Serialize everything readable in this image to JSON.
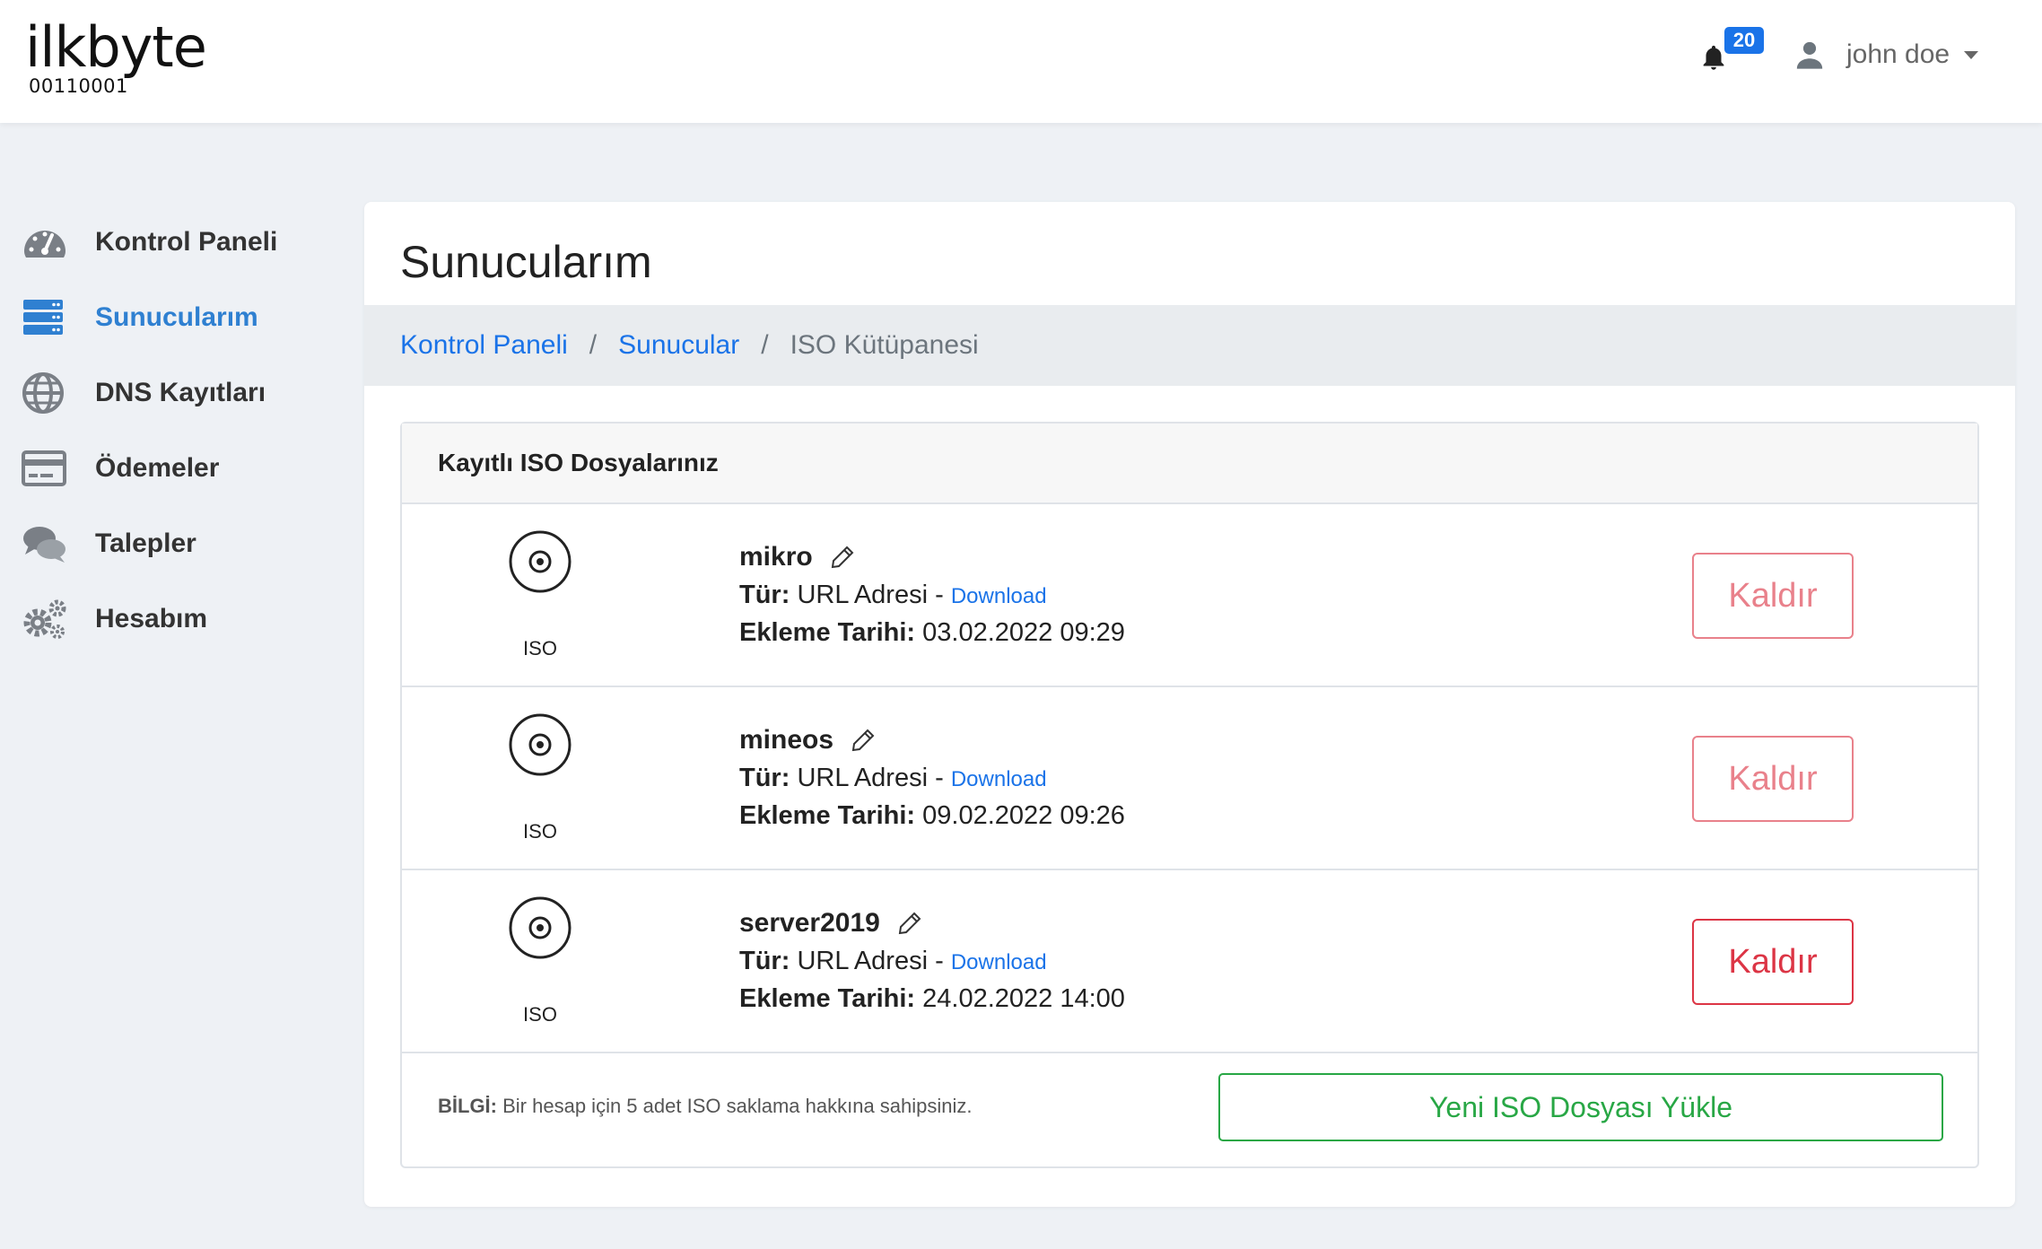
{
  "brand": {
    "name": "ilkbyte",
    "tagline": "00110001"
  },
  "header": {
    "notification_count": "20",
    "user_name": "john doe"
  },
  "sidebar": {
    "items": [
      {
        "label": "Kontrol Paneli",
        "icon": "dashboard-gauge-icon",
        "active": false
      },
      {
        "label": "Sunucularım",
        "icon": "server-icon",
        "active": true
      },
      {
        "label": "DNS Kayıtları",
        "icon": "globe-icon",
        "active": false
      },
      {
        "label": "Ödemeler",
        "icon": "credit-card-icon",
        "active": false
      },
      {
        "label": "Talepler",
        "icon": "chat-bubbles-icon",
        "active": false
      },
      {
        "label": "Hesabım",
        "icon": "gears-icon",
        "active": false
      }
    ]
  },
  "page": {
    "title": "Sunucularım",
    "breadcrumb": [
      "Kontrol Paneli",
      "Sunucular",
      "ISO Kütüpanesi"
    ],
    "separator": "/"
  },
  "panel": {
    "title": "Kayıtlı ISO Dosyalarınız",
    "type_label": "Tür:",
    "date_label": "Ekleme Tarihi:",
    "dash": "-",
    "iso_rows": [
      {
        "icon_label": "ISO",
        "name": "mikro",
        "type": "URL Adresi",
        "download": "Download",
        "date": "03.02.2022 09:29",
        "remove": "Kaldır"
      },
      {
        "icon_label": "ISO",
        "name": "mineos",
        "type": "URL Adresi",
        "download": "Download",
        "date": "09.02.2022 09:26",
        "remove": "Kaldır"
      },
      {
        "icon_label": "ISO",
        "name": "server2019",
        "type": "URL Adresi",
        "download": "Download",
        "date": "24.02.2022 14:00",
        "remove": "Kaldır"
      }
    ],
    "info_label": "BİLGİ:",
    "info_text": "Bir hesap için 5 adet ISO saklama hakkına sahipsiniz.",
    "upload_button": "Yeni ISO Dosyası Yükle"
  },
  "colors": {
    "accent": "#1a73e8",
    "sidebar_active": "#2f80d1",
    "danger": "#dc3545",
    "success": "#28a745"
  }
}
